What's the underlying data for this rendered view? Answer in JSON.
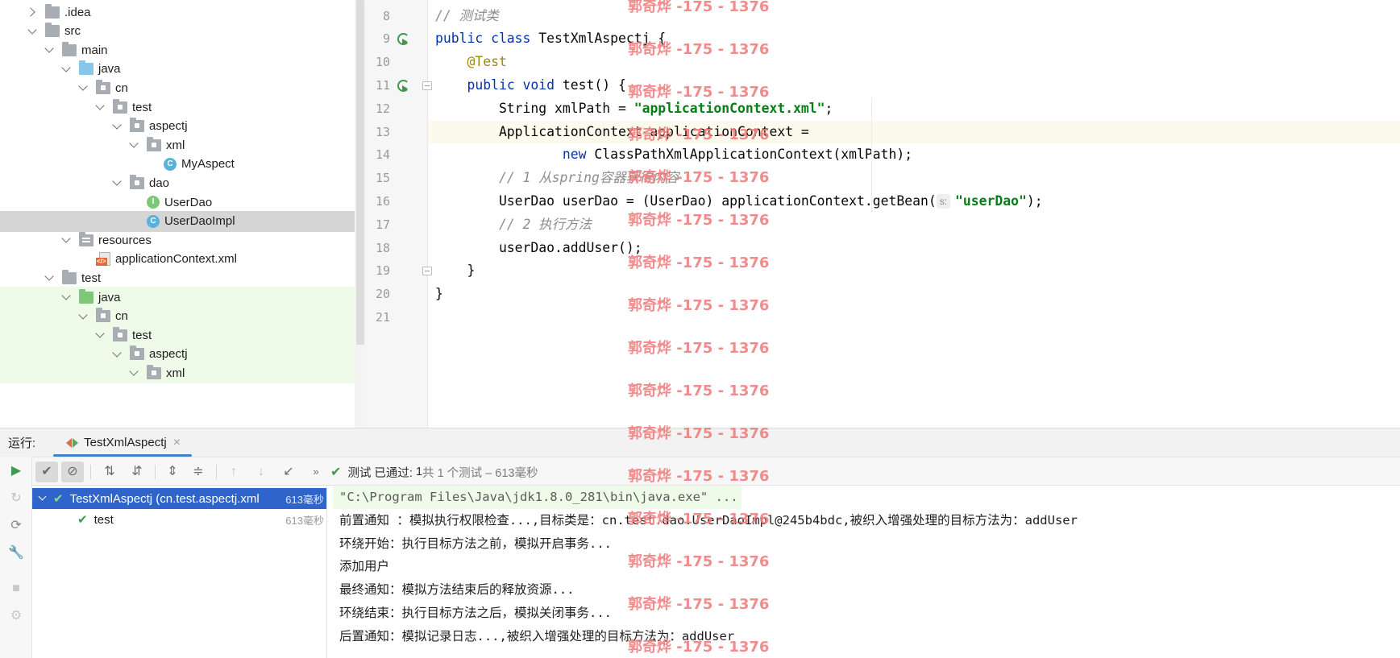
{
  "tree": {
    "items": [
      {
        "label": ".idea",
        "depth": 0,
        "chevron": "right",
        "icon": "folder-icon"
      },
      {
        "label": "src",
        "depth": 0,
        "chevron": "down",
        "icon": "folder-icon"
      },
      {
        "label": "main",
        "depth": 1,
        "chevron": "down",
        "icon": "folder-icon"
      },
      {
        "label": "java",
        "depth": 2,
        "chevron": "down",
        "icon": "source-folder-icon"
      },
      {
        "label": "cn",
        "depth": 3,
        "chevron": "down",
        "icon": "package-icon"
      },
      {
        "label": "test",
        "depth": 4,
        "chevron": "down",
        "icon": "package-icon"
      },
      {
        "label": "aspectj",
        "depth": 5,
        "chevron": "down",
        "icon": "package-icon"
      },
      {
        "label": "xml",
        "depth": 6,
        "chevron": "down",
        "icon": "package-icon"
      },
      {
        "label": "MyAspect",
        "depth": 7,
        "chevron": "none",
        "icon": "class-icon"
      },
      {
        "label": "dao",
        "depth": 5,
        "chevron": "down",
        "icon": "package-icon"
      },
      {
        "label": "UserDao",
        "depth": 6,
        "chevron": "none",
        "icon": "interface-icon"
      },
      {
        "label": "UserDaoImpl",
        "depth": 6,
        "chevron": "none",
        "icon": "class-icon",
        "selected": true
      },
      {
        "label": "resources",
        "depth": 2,
        "chevron": "down",
        "icon": "resources-folder-icon"
      },
      {
        "label": "applicationContext.xml",
        "depth": 3,
        "chevron": "none",
        "icon": "xml-file-icon"
      },
      {
        "label": "test",
        "depth": 1,
        "chevron": "down",
        "icon": "folder-icon"
      },
      {
        "label": "java",
        "depth": 2,
        "chevron": "down",
        "icon": "test-folder-icon",
        "green": true
      },
      {
        "label": "cn",
        "depth": 3,
        "chevron": "down",
        "icon": "package-icon",
        "green": true
      },
      {
        "label": "test",
        "depth": 4,
        "chevron": "down",
        "icon": "package-icon",
        "green": true
      },
      {
        "label": "aspectj",
        "depth": 5,
        "chevron": "down",
        "icon": "package-icon",
        "green": true
      },
      {
        "label": "xml",
        "depth": 6,
        "chevron": "down",
        "icon": "package-icon",
        "green": true
      }
    ]
  },
  "editor": {
    "lines": [
      {
        "num": "8",
        "html": "<span class='cm'>// 测试类</span>"
      },
      {
        "num": "9",
        "html": "<span class='kw'>public class</span> TestXmlAspectj {",
        "run": true
      },
      {
        "num": "10",
        "html": "    <span class='an'>@Test</span>"
      },
      {
        "num": "11",
        "html": "    <span class='kw'>public void</span> test() {",
        "run": true,
        "fold": true
      },
      {
        "num": "12",
        "html": "        String xmlPath = <span class='st'>\"applicationContext.xml\"</span>;"
      },
      {
        "num": "13",
        "html": "        ApplicationContext applicationContext =",
        "current": true
      },
      {
        "num": "14",
        "html": "                <span class='kw'>new</span> ClassPathXmlApplicationContext(xmlPath);"
      },
      {
        "num": "15",
        "html": "        <span class='cm'>// 1 从spring容器获得内容</span>"
      },
      {
        "num": "16",
        "html": "        UserDao userDao = (UserDao) applicationContext.getBean(<span class='hint'>s:</span><span class='st'>\"userDao\"</span>);"
      },
      {
        "num": "17",
        "html": "        <span class='cm'>// 2 执行方法</span>"
      },
      {
        "num": "18",
        "html": "        userDao.addUser();"
      },
      {
        "num": "19",
        "html": "    }",
        "fold": true
      },
      {
        "num": "20",
        "html": "}"
      },
      {
        "num": "21",
        "html": ""
      }
    ]
  },
  "watermark": {
    "text": "郭奇烨 -175 - 1376"
  },
  "run": {
    "label": "运行:",
    "tab_label": "TestXmlAspectj",
    "tab_close": "×",
    "status": {
      "check": "✔",
      "passed": "测试 已通过:",
      "count": "1",
      "detail": "共 1 个测试 – 613毫秒"
    },
    "tests": [
      {
        "label": "TestXmlAspectj (cn.test.aspectj.xml",
        "duration": "613毫秒",
        "selected": true
      },
      {
        "label": "test",
        "duration": "613毫秒"
      }
    ],
    "console": [
      "\"C:\\Program Files\\Java\\jdk1.8.0_281\\bin\\java.exe\" ...",
      "前置通知 ：模拟执行权限检查...,目标类是：cn.test.dao.UserDaoImpl@245b4bdc,被织入增强处理的目标方法为：addUser",
      "环绕开始：执行目标方法之前，模拟开启事务...",
      "添加用户",
      "最终通知：模拟方法结束后的释放资源...",
      "环绕结束：执行目标方法之后，模拟关闭事务...",
      "后置通知：模拟记录日志...,被织入增强处理的目标方法为：addUser"
    ]
  },
  "toolbar_icons": [
    "rerun-icon",
    "show-passed-icon",
    "show-ignored-icon",
    "sort-alpha-icon",
    "sort-duration-icon",
    "expand-all-icon",
    "collapse-all-icon",
    "prev-failed-icon",
    "next-failed-icon",
    "import-tests-icon",
    "more-icon"
  ]
}
